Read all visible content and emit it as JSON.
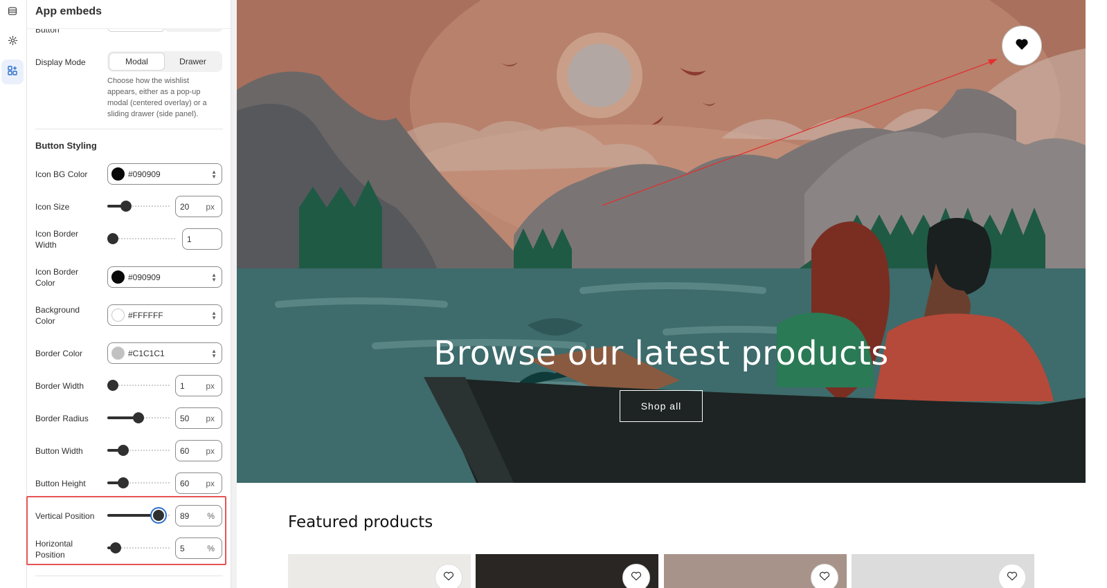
{
  "panel": {
    "title": "App embeds",
    "cut_row_label": "Button",
    "display_mode": {
      "label": "Display Mode",
      "options": [
        "Modal",
        "Drawer"
      ],
      "selected": "Modal",
      "help": "Choose how the wishlist appears, either as a pop-up modal (centered overlay) or a sliding drawer (side panel)."
    },
    "section_title": "Button Styling",
    "icon_bg_color": {
      "label": "Icon BG Color",
      "value": "#090909"
    },
    "icon_size": {
      "label": "Icon Size",
      "value": "20",
      "unit": "px",
      "level": 0.25
    },
    "icon_border_width": {
      "label": "Icon Border Width",
      "value": "1",
      "level": 0.0
    },
    "icon_border_color": {
      "label": "Icon Border Color",
      "value": "#090909"
    },
    "background_color": {
      "label": "Background Color",
      "value": "#FFFFFF"
    },
    "border_color": {
      "label": "Border Color",
      "value": "#C1C1C1"
    },
    "border_width": {
      "label": "Border Width",
      "value": "1",
      "unit": "px",
      "level": 0.0
    },
    "border_radius": {
      "label": "Border Radius",
      "value": "50",
      "unit": "px",
      "level": 0.5
    },
    "button_width": {
      "label": "Button Width",
      "value": "60",
      "unit": "px",
      "level": 0.2
    },
    "button_height": {
      "label": "Button Height",
      "value": "60",
      "unit": "px",
      "level": 0.2
    },
    "vertical_position": {
      "label": "Vertical Position",
      "value": "89",
      "unit": "%",
      "level": 0.89
    },
    "horizontal_position": {
      "label": "Horizontal Position",
      "value": "5",
      "unit": "%",
      "level": 0.05
    }
  },
  "preview": {
    "hero_title": "Browse our latest products",
    "shop_button": "Shop all",
    "featured_title": "Featured products"
  },
  "colors": {
    "accent": "#2c6ecb",
    "highlight": "#e45454",
    "sky": "#b97f68",
    "water": "#3e6b6b"
  },
  "icons": [
    "embed-list-icon",
    "gear-icon",
    "apps-icon",
    "heart-icon"
  ]
}
